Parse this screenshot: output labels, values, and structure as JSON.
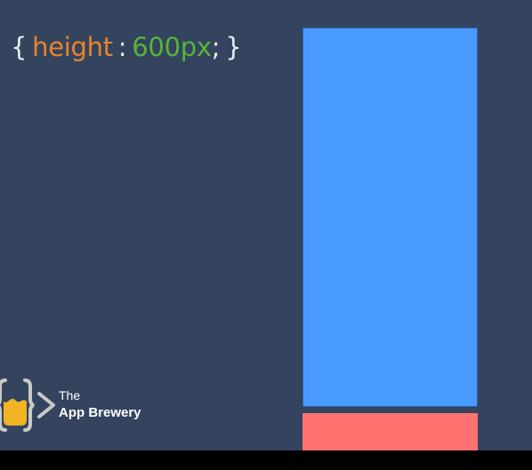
{
  "code": {
    "open_brace": "{",
    "property": "height",
    "colon": ":",
    "value_number": "600",
    "value_unit": "px",
    "semicolon": ";",
    "close_brace": "}"
  },
  "logo": {
    "the": "The",
    "name": "App Brewery"
  },
  "colors": {
    "background": "#34445e",
    "text_default": "#e8eaee",
    "property": "#e9832c",
    "value": "#56b43b",
    "blue_box": "#4a9bff",
    "red_box": "#ff7270",
    "logo_cup": "#f0b323",
    "logo_outline": "#c9c9c9"
  }
}
